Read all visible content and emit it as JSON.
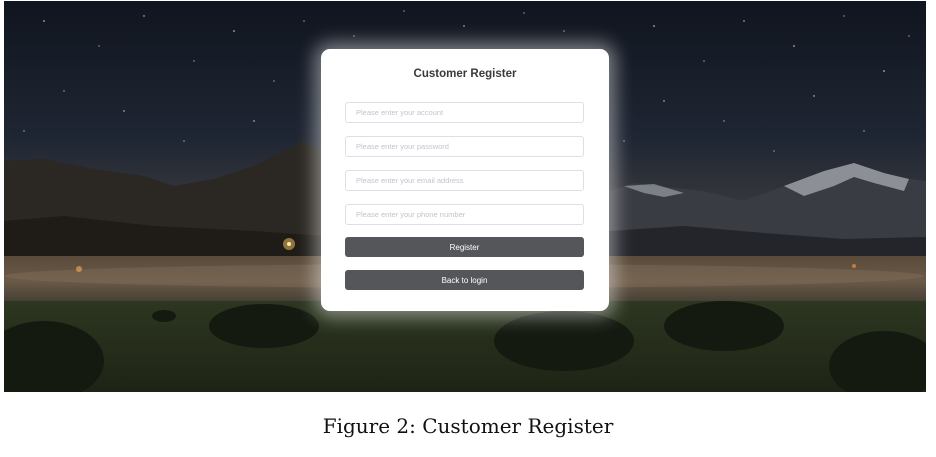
{
  "form": {
    "title": "Customer Register",
    "fields": {
      "account_placeholder": "Please enter your account",
      "password_placeholder": "Please enter your password",
      "email_placeholder": "Please enter your email address",
      "phone_placeholder": "Please enter your phone number"
    },
    "register_label": "Register",
    "back_label": "Back to login"
  },
  "caption": "Figure 2: Customer Register",
  "colors": {
    "button_bg": "#545659",
    "card_bg": "#ffffff",
    "sky_top": "#10151f"
  }
}
